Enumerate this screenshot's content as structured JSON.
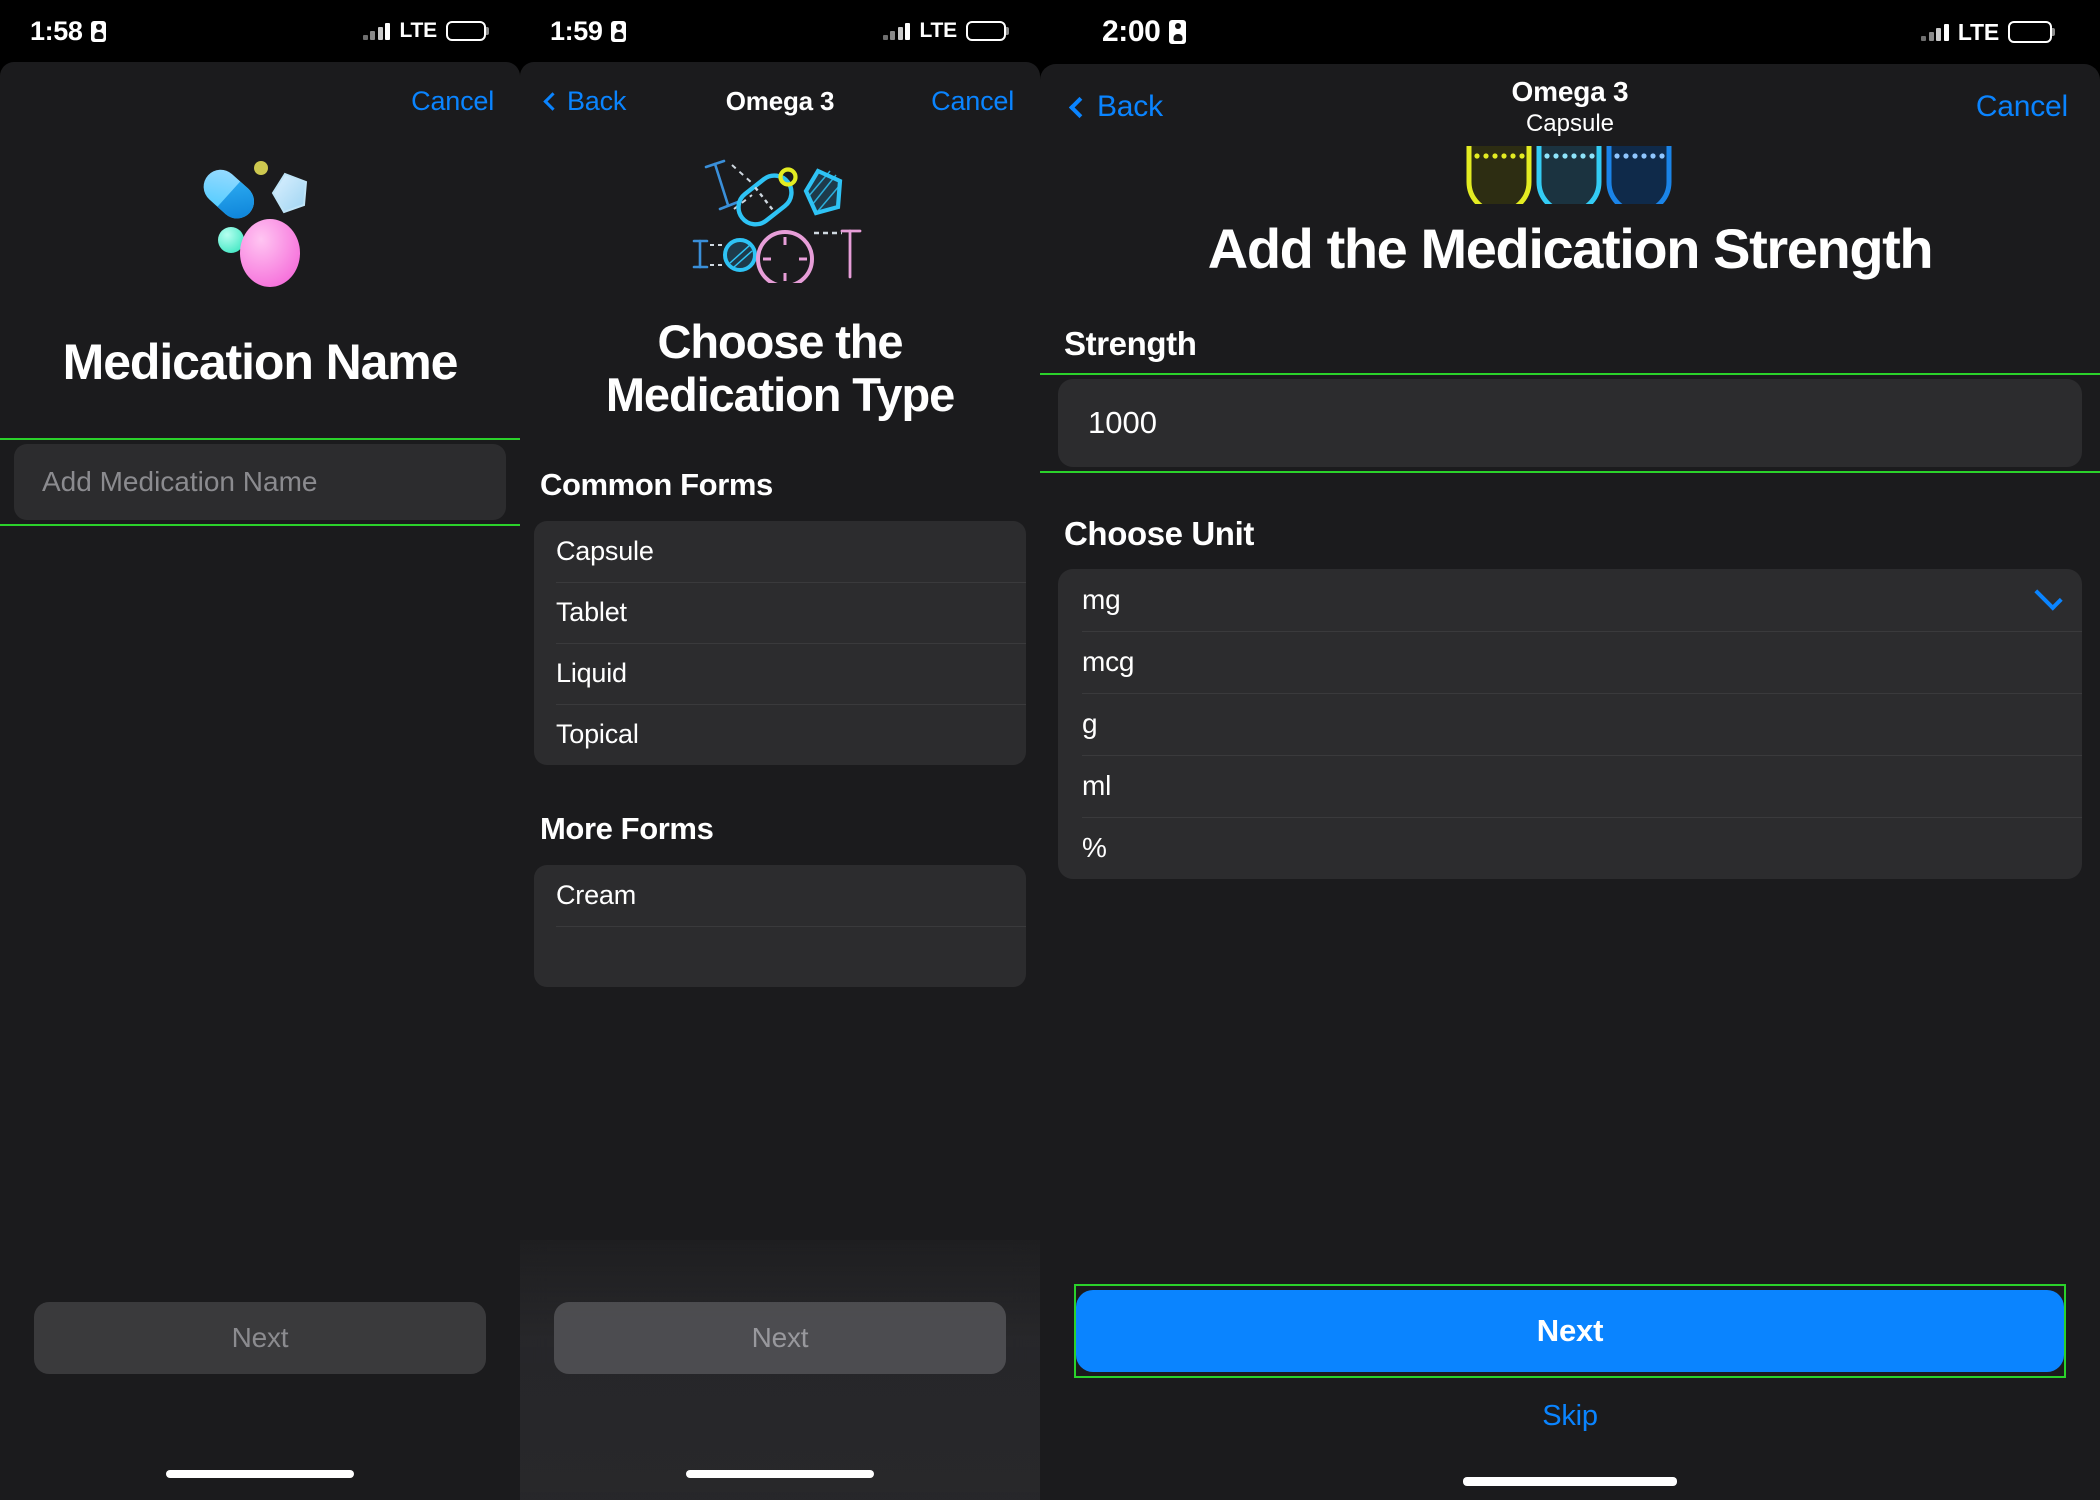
{
  "screens": [
    {
      "id": "medication-name",
      "status": {
        "time": "1:58",
        "carrier": "LTE",
        "record_icon": "record-icon"
      },
      "nav": {
        "cancel": "Cancel"
      },
      "title": "Medication Name",
      "input": {
        "placeholder": "Add Medication Name",
        "value": ""
      },
      "primary_button": {
        "label": "Next",
        "enabled": false
      }
    },
    {
      "id": "medication-type",
      "status": {
        "time": "1:59",
        "carrier": "LTE",
        "record_icon": "record-icon"
      },
      "nav": {
        "back": "Back",
        "title": "Omega 3",
        "cancel": "Cancel"
      },
      "title": "Choose the Medication Type",
      "sections": [
        {
          "header": "Common Forms",
          "items": [
            "Capsule",
            "Tablet",
            "Liquid",
            "Topical"
          ]
        },
        {
          "header": "More Forms",
          "items": [
            "Cream"
          ]
        }
      ],
      "primary_button": {
        "label": "Next",
        "enabled": false
      }
    },
    {
      "id": "medication-strength",
      "status": {
        "time": "2:00",
        "carrier": "LTE",
        "record_icon": "record-icon"
      },
      "nav": {
        "back": "Back",
        "title": "Omega 3",
        "subtitle": "Capsule",
        "cancel": "Cancel"
      },
      "title": "Add the Medication Strength",
      "strength": {
        "label": "Strength",
        "value": "1000"
      },
      "unit": {
        "label": "Choose Unit",
        "options": [
          "mg",
          "mcg",
          "g",
          "ml",
          "%"
        ],
        "selected": "mg"
      },
      "primary_button": {
        "label": "Next",
        "enabled": true
      },
      "skip_button": {
        "label": "Skip"
      }
    }
  ],
  "colors": {
    "accent_blue": "#0a84ff",
    "focus_green": "#2bd22b",
    "sheet_bg": "#1b1b1d",
    "card_bg": "#2c2c2e",
    "disabled_bg": "#3a3a3c",
    "muted_text": "#8b8b8f"
  }
}
